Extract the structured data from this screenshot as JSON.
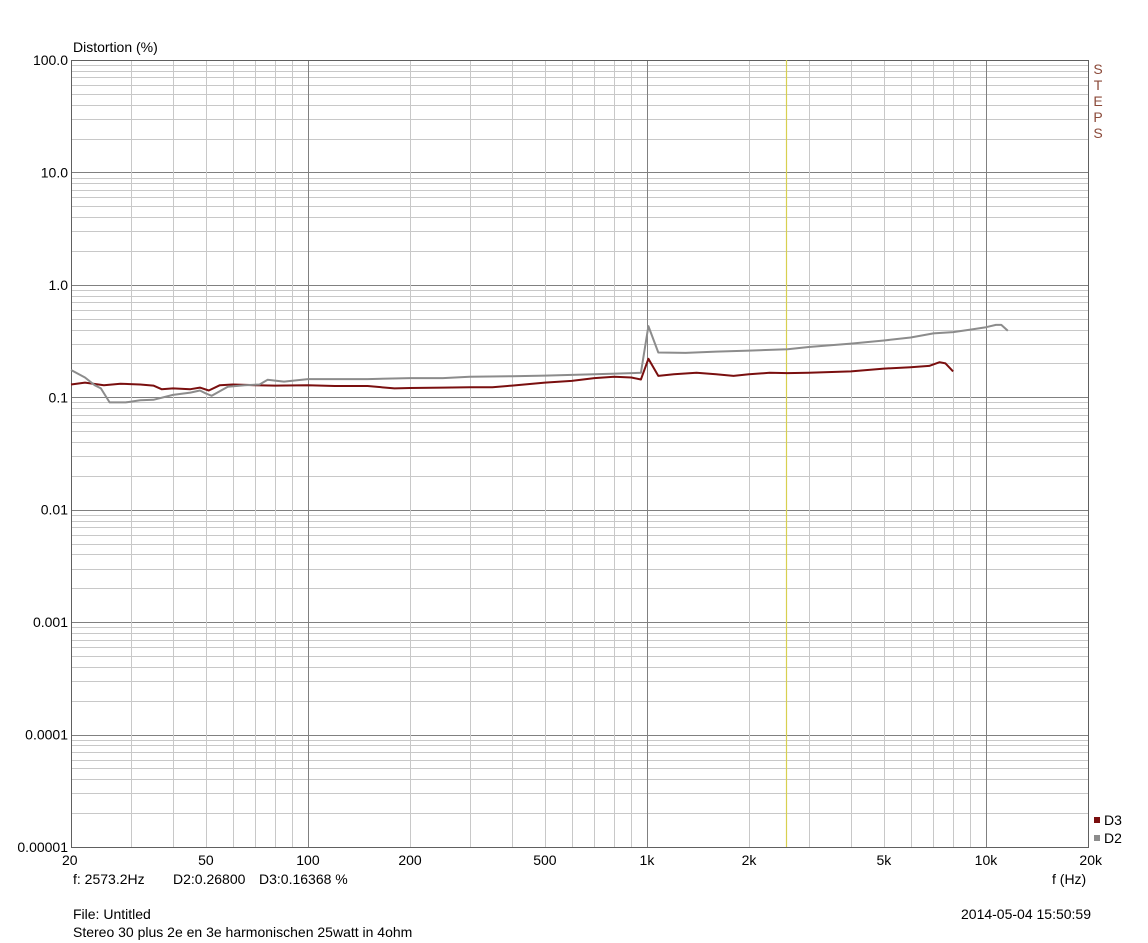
{
  "chart_data": {
    "type": "line",
    "ylabel": "Distortion (%)",
    "xlabel": "f (Hz)",
    "x_scale": "log",
    "y_scale": "log",
    "xlim": [
      20,
      20000
    ],
    "ylim": [
      1e-05,
      100
    ],
    "grid": true,
    "x_ticks": [
      {
        "v": 20,
        "label": "20"
      },
      {
        "v": 50,
        "label": "50"
      },
      {
        "v": 100,
        "label": "100"
      },
      {
        "v": 200,
        "label": "200"
      },
      {
        "v": 500,
        "label": "500"
      },
      {
        "v": 1000,
        "label": "1k"
      },
      {
        "v": 2000,
        "label": "2k"
      },
      {
        "v": 5000,
        "label": "5k"
      },
      {
        "v": 10000,
        "label": "10k"
      },
      {
        "v": 20000,
        "label": "20k"
      }
    ],
    "y_ticks": [
      {
        "v": 100,
        "label": "100.0"
      },
      {
        "v": 10,
        "label": "10.0"
      },
      {
        "v": 1,
        "label": "1.0"
      },
      {
        "v": 0.1,
        "label": "0.1"
      },
      {
        "v": 0.01,
        "label": "0.01"
      },
      {
        "v": 0.001,
        "label": "0.001"
      },
      {
        "v": 0.0001,
        "label": "0.0001"
      },
      {
        "v": 1e-05,
        "label": "0.00001"
      }
    ],
    "cursor_x": 2573.2,
    "legend_position": "bottom-right",
    "series": [
      {
        "name": "D3",
        "color": "#7a0f0f",
        "points": [
          [
            20,
            0.13
          ],
          [
            22,
            0.135
          ],
          [
            25,
            0.128
          ],
          [
            28,
            0.132
          ],
          [
            32,
            0.13
          ],
          [
            35,
            0.127
          ],
          [
            37,
            0.118
          ],
          [
            40,
            0.12
          ],
          [
            45,
            0.118
          ],
          [
            48,
            0.122
          ],
          [
            51,
            0.115
          ],
          [
            55,
            0.128
          ],
          [
            60,
            0.13
          ],
          [
            70,
            0.128
          ],
          [
            80,
            0.127
          ],
          [
            100,
            0.128
          ],
          [
            120,
            0.126
          ],
          [
            150,
            0.126
          ],
          [
            180,
            0.12
          ],
          [
            200,
            0.121
          ],
          [
            250,
            0.122
          ],
          [
            300,
            0.123
          ],
          [
            350,
            0.123
          ],
          [
            400,
            0.127
          ],
          [
            500,
            0.135
          ],
          [
            600,
            0.14
          ],
          [
            700,
            0.148
          ],
          [
            800,
            0.152
          ],
          [
            900,
            0.15
          ],
          [
            960,
            0.144
          ],
          [
            1010,
            0.22
          ],
          [
            1080,
            0.155
          ],
          [
            1200,
            0.16
          ],
          [
            1400,
            0.165
          ],
          [
            1600,
            0.16
          ],
          [
            1800,
            0.155
          ],
          [
            2000,
            0.16
          ],
          [
            2300,
            0.165
          ],
          [
            2600,
            0.164
          ],
          [
            3000,
            0.165
          ],
          [
            4000,
            0.17
          ],
          [
            5000,
            0.18
          ],
          [
            6000,
            0.185
          ],
          [
            6800,
            0.19
          ],
          [
            7300,
            0.205
          ],
          [
            7600,
            0.2
          ],
          [
            8000,
            0.17
          ]
        ]
      },
      {
        "name": "D2",
        "color": "#8c8c8c",
        "points": [
          [
            20,
            0.175
          ],
          [
            22,
            0.15
          ],
          [
            23.5,
            0.128
          ],
          [
            24.5,
            0.12
          ],
          [
            26,
            0.09
          ],
          [
            29,
            0.09
          ],
          [
            32,
            0.094
          ],
          [
            35,
            0.095
          ],
          [
            40,
            0.105
          ],
          [
            45,
            0.11
          ],
          [
            48,
            0.115
          ],
          [
            50,
            0.108
          ],
          [
            52,
            0.103
          ],
          [
            58,
            0.124
          ],
          [
            65,
            0.128
          ],
          [
            72,
            0.13
          ],
          [
            76,
            0.143
          ],
          [
            85,
            0.138
          ],
          [
            100,
            0.145
          ],
          [
            150,
            0.145
          ],
          [
            200,
            0.148
          ],
          [
            250,
            0.148
          ],
          [
            300,
            0.152
          ],
          [
            400,
            0.154
          ],
          [
            500,
            0.156
          ],
          [
            700,
            0.16
          ],
          [
            960,
            0.165
          ],
          [
            1010,
            0.43
          ],
          [
            1080,
            0.25
          ],
          [
            1300,
            0.248
          ],
          [
            1600,
            0.255
          ],
          [
            2000,
            0.26
          ],
          [
            2600,
            0.268
          ],
          [
            3000,
            0.28
          ],
          [
            4000,
            0.3
          ],
          [
            5000,
            0.32
          ],
          [
            6000,
            0.34
          ],
          [
            7000,
            0.37
          ],
          [
            8000,
            0.38
          ],
          [
            9000,
            0.4
          ],
          [
            10000,
            0.42
          ],
          [
            10700,
            0.44
          ],
          [
            11100,
            0.44
          ],
          [
            11600,
            0.39
          ]
        ]
      }
    ]
  },
  "ytitle": "Distortion (%)",
  "xunit": "f (Hz)",
  "brand": [
    "S",
    "T",
    "E",
    "P",
    "S"
  ],
  "readout": {
    "f": "f: 2573.2Hz",
    "d2": "D2:0.26800",
    "d3": "D3:0.16368 %"
  },
  "legend": [
    {
      "name": "D3",
      "color": "#7a0f0f"
    },
    {
      "name": "D2",
      "color": "#8c8c8c"
    }
  ],
  "footer": {
    "file": "File: Untitled",
    "description": "Stereo 30 plus 2e en 3e harmonischen 25watt in 4ohm",
    "timestamp": "2014-05-04 15:50:59"
  },
  "colors": {
    "grid_major": "#808080",
    "grid_minor": "#c8c8c8",
    "cursor": "#d8d050",
    "brand": "#8b4a3a"
  }
}
